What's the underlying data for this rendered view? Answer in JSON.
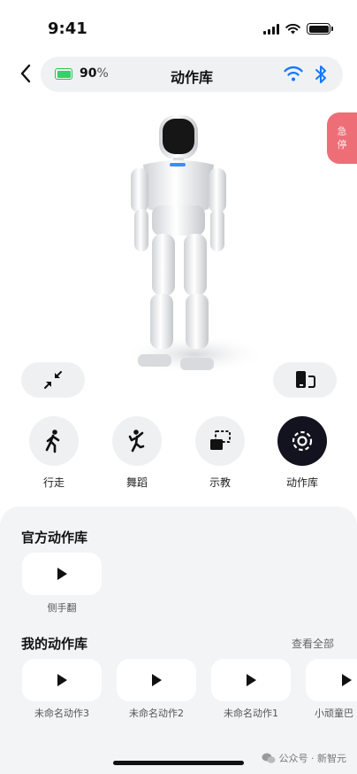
{
  "status_bar": {
    "time": "9:41"
  },
  "header": {
    "battery_value": "90",
    "battery_unit": "%",
    "title": "动作库"
  },
  "estop": {
    "line1": "急",
    "line2": "停"
  },
  "modes": [
    {
      "label": "行走",
      "icon": "walk-icon",
      "active": false
    },
    {
      "label": "舞蹈",
      "icon": "dance-icon",
      "active": false
    },
    {
      "label": "示教",
      "icon": "teach-icon",
      "active": false
    },
    {
      "label": "动作库",
      "icon": "action-library-icon",
      "active": true
    }
  ],
  "official_library": {
    "title": "官方动作库",
    "items": [
      {
        "label": "侧手翻"
      }
    ]
  },
  "my_library": {
    "title": "我的动作库",
    "view_all": "查看全部",
    "items": [
      {
        "label": "未命名动作3"
      },
      {
        "label": "未命名动作2"
      },
      {
        "label": "未命名动作1"
      },
      {
        "label": "小顽童巴"
      }
    ]
  },
  "watermark": {
    "text": "公众号 · 新智元"
  },
  "colors": {
    "accent": "#1677ff",
    "estop": "#ee6e78",
    "battery": "#34d16b",
    "active_mode": "#12131e"
  }
}
